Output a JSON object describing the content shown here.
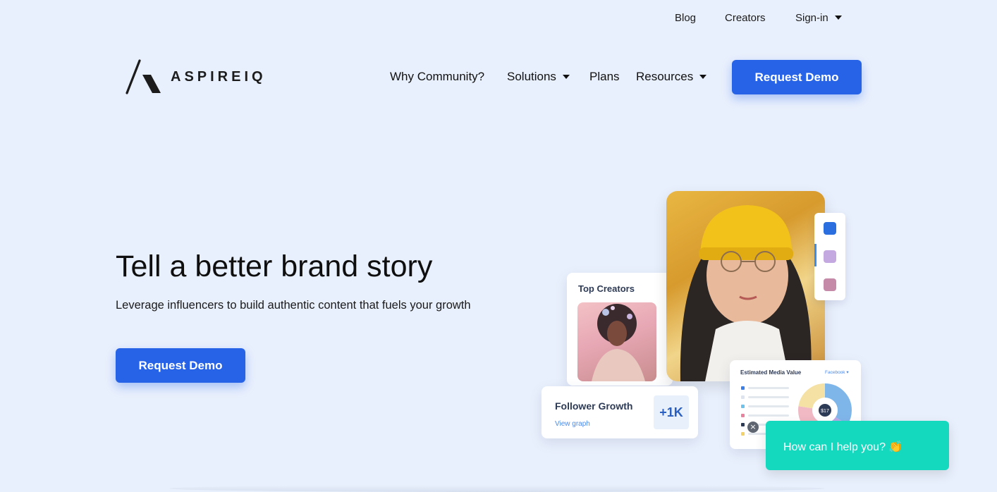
{
  "top_nav": {
    "blog": "Blog",
    "creators": "Creators",
    "signin": "Sign-in"
  },
  "logo": {
    "text": "ASPIREIQ"
  },
  "main_nav": {
    "why_community": "Why Community?",
    "solutions": "Solutions",
    "plans": "Plans",
    "resources": "Resources",
    "request_demo": "Request Demo"
  },
  "hero": {
    "title": "Tell a better brand story",
    "subtitle": "Leverage influencers to build authentic content that fuels your growth",
    "cta": "Request Demo"
  },
  "illustration": {
    "top_creators": "Top Creators",
    "follower_growth": "Follower Growth",
    "view_graph": "View graph",
    "follower_value": "+1K",
    "emv_title": "Estimated Media Value",
    "emv_select": "Facebook",
    "emv_center_value": "$17"
  },
  "chat": {
    "message": "How can I help you? 👏",
    "close_glyph": "×"
  },
  "colors": {
    "background": "#e9f0fd",
    "primary_button": "#2663e7",
    "chat": "#14d9bf",
    "link": "#4b89ea"
  }
}
